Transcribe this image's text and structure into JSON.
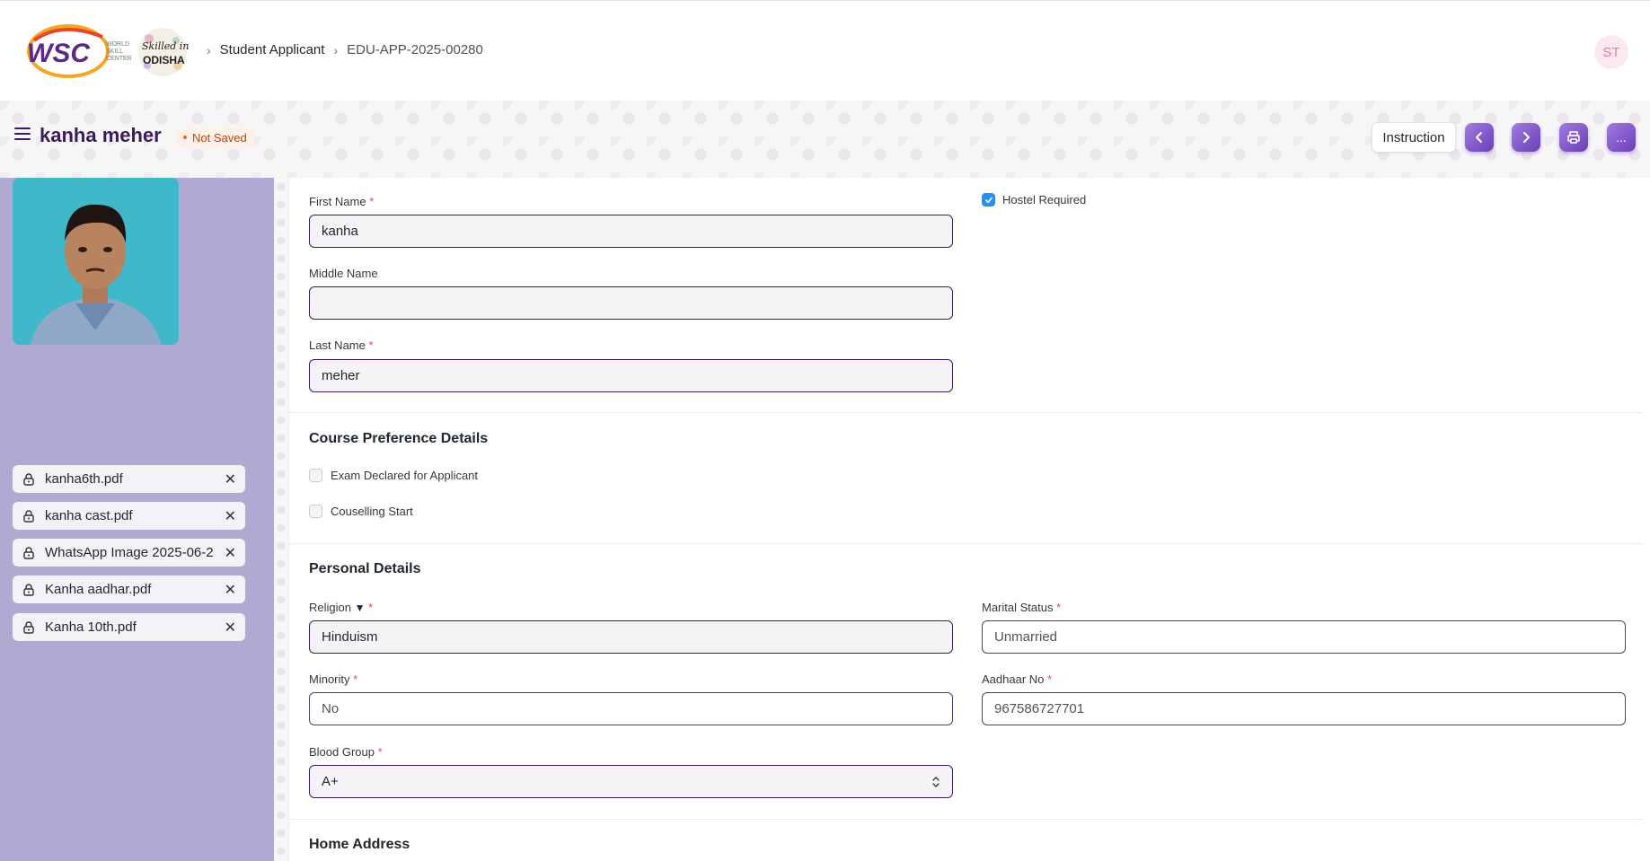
{
  "brand": {
    "logo_main": "WSC",
    "logo_sub": "WORLD SKILL CENTER",
    "logo2_line1": "Skilled in",
    "logo2_line2": "ODISHA"
  },
  "breadcrumb": {
    "doctype": "Student Applicant",
    "current": "EDU-APP-2025-00280"
  },
  "user": {
    "initials": "ST"
  },
  "page": {
    "title": "kanha meher",
    "status": "Not Saved"
  },
  "actions": {
    "instruction_label": "Instruction",
    "prev_icon": "chevron-left-icon",
    "next_icon": "chevron-right-icon",
    "print_icon": "printer-icon",
    "more_label": "..."
  },
  "attachments": [
    {
      "name": "kanha6th.pdf"
    },
    {
      "name": "kanha cast.pdf"
    },
    {
      "name": "WhatsApp Image 2025-06-2"
    },
    {
      "name": "Kanha aadhar.pdf"
    },
    {
      "name": "Kanha 10th.pdf"
    }
  ],
  "form": {
    "first_name": {
      "label": "First Name",
      "value": "kanha"
    },
    "middle_name": {
      "label": "Middle Name",
      "value": ""
    },
    "last_name": {
      "label": "Last Name",
      "value": "meher"
    },
    "hostel_required": {
      "label": "Hostel Required",
      "checked": true
    },
    "course_section": {
      "title": "Course Preference Details"
    },
    "exam_declared": {
      "label": "Exam Declared for Applicant",
      "checked": false
    },
    "couselling_start": {
      "label": "Couselling Start",
      "checked": false
    },
    "personal_section": {
      "title": "Personal Details"
    },
    "religion": {
      "label": "Religion",
      "value": "Hinduism"
    },
    "marital_status": {
      "label": "Marital Status",
      "value": "Unmarried"
    },
    "minority": {
      "label": "Minority",
      "value": "No"
    },
    "aadhaar_no": {
      "label": "Aadhaar No",
      "value": "967586727701"
    },
    "blood_group": {
      "label": "Blood Group",
      "value": "A+"
    },
    "home_section": {
      "title": "Home Address"
    }
  },
  "colors": {
    "brand_purple": "#3a1b5c",
    "sidebar": "#b1a9d2",
    "button_purple": "#7a52c8",
    "required": "#e24c4c",
    "check_blue": "#2490ef"
  }
}
